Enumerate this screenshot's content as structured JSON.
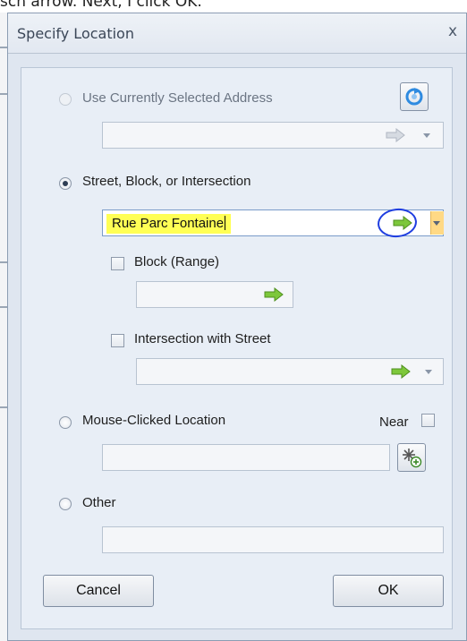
{
  "caption": {
    "text": "sch arrow. Next, I click OK."
  },
  "dialog": {
    "title": "Specify Location",
    "close_glyph": "x"
  },
  "options": {
    "use_selected": {
      "label": "Use Currently Selected Address",
      "enabled": false,
      "selected": false,
      "refresh_icon": "refresh-icon"
    },
    "street": {
      "label": "Street, Block, or Intersection",
      "selected": true,
      "value": "Rue Parc Fontaine",
      "go_icon": "green-arrow-icon"
    },
    "block": {
      "label": "Block (Range)",
      "checked": false
    },
    "intersection": {
      "label": "Intersection with Street",
      "checked": false
    },
    "mouse_clicked": {
      "label": "Mouse-Clicked Location",
      "selected": false,
      "near_label": "Near",
      "near_checked": false,
      "pick_icon": "map-pick-icon"
    },
    "other": {
      "label": "Other",
      "selected": false
    }
  },
  "buttons": {
    "cancel": "Cancel",
    "ok": "OK"
  },
  "colors": {
    "highlight": "#ffff55",
    "annotation": "#1f3ee0",
    "arrow": "#7dc73b"
  }
}
